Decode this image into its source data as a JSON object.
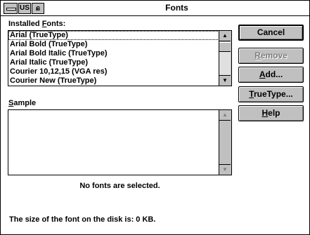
{
  "window": {
    "title": "Fonts",
    "ime_mode": "US",
    "ime_icon": "ɕ"
  },
  "installed_fonts": {
    "label_pre": "Installed ",
    "label_accel": "F",
    "label_post": "onts:",
    "items": [
      "Arial (TrueType)",
      "Arial Bold (TrueType)",
      "Arial Bold Italic (TrueType)",
      "Arial Italic (TrueType)",
      "Courier 10,12,15 (VGA res)",
      "Courier New (TrueType)"
    ]
  },
  "sample": {
    "label_accel": "S",
    "label_post": "ample",
    "status": "No fonts are selected."
  },
  "disk": {
    "text": "The size of the font on the disk is:  0 KB."
  },
  "buttons": {
    "cancel": "Cancel",
    "remove_accel": "R",
    "remove_post": "emove",
    "add_accel": "A",
    "add_post": "dd...",
    "truetype_accel": "T",
    "truetype_post": "rueType...",
    "help_accel": "H",
    "help_post": "elp"
  },
  "colors": {
    "face": "#c0c0c0",
    "disabled_text": "#808080"
  }
}
